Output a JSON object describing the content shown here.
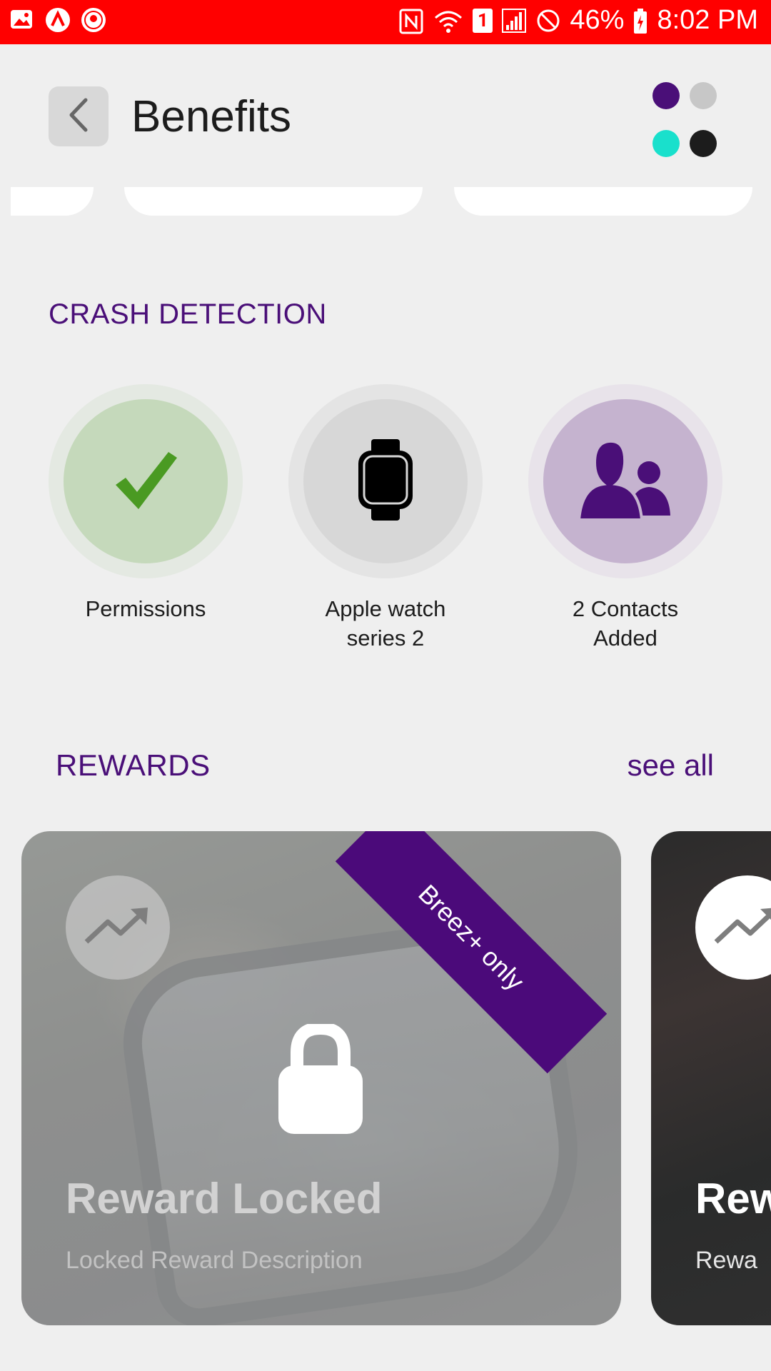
{
  "status_bar": {
    "battery": "46%",
    "time": "8:02 PM",
    "sim_slot": "1",
    "icons": [
      "gallery-icon",
      "app-icon",
      "badge-icon",
      "nfc-icon",
      "wifi-icon",
      "signal-icon",
      "blocked-icon",
      "battery-icon"
    ]
  },
  "header": {
    "title": "Benefits",
    "theme_colors": [
      "#4a0f78",
      "#c7c7c7",
      "#19e0cc",
      "#1c1c1c"
    ]
  },
  "crash_detection": {
    "title": "CRASH DETECTION",
    "items": [
      {
        "label": "Permissions",
        "icon": "checkmark-icon"
      },
      {
        "label": "Apple watch series 2",
        "icon": "watch-icon"
      },
      {
        "label": "2 Contacts Added",
        "icon": "contacts-icon"
      }
    ]
  },
  "rewards": {
    "title": "REWARDS",
    "see_all": "see all",
    "cards": [
      {
        "title": "Reward Locked",
        "description": "Locked Reward Description",
        "ribbon": "Breez+ only",
        "locked": true
      },
      {
        "title": "Rew",
        "description": "Rewa",
        "locked": false
      }
    ]
  },
  "colors": {
    "status_bar": "#ff0000",
    "accent_purple": "#4a0f78",
    "permission_green": "#4a9a22"
  }
}
